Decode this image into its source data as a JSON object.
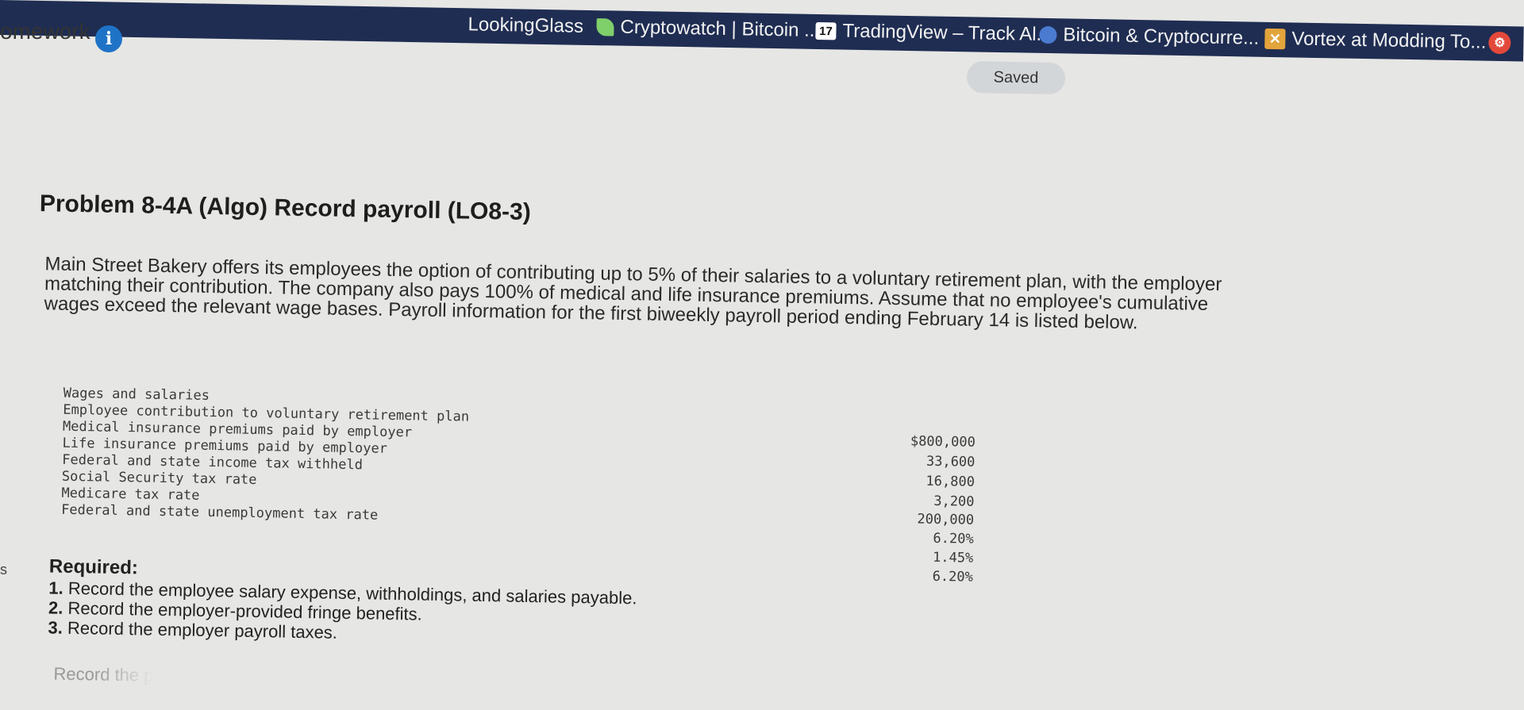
{
  "bookmarks": [
    {
      "label": "LookingGlass",
      "icon": "none-icon"
    },
    {
      "label": "Cryptowatch | Bitcoin ...",
      "icon": "leaf-icon"
    },
    {
      "label": "TradingView – Track Al...",
      "icon": "tradingview-icon",
      "icon_text": "17"
    },
    {
      "label": "Bitcoin & Cryptocurre...",
      "icon": "circle-icon"
    },
    {
      "label": "Vortex at Modding To...",
      "icon": "x-icon"
    }
  ],
  "app": {
    "title": "omework",
    "info_glyph": "i",
    "saved_label": "Saved"
  },
  "problem": {
    "title": "Problem 8-4A (Algo) Record payroll (LO8-3)",
    "description": "Main Street Bakery offers its employees the option of contributing up to 5% of their salaries to a voluntary retirement plan, with the employer matching their contribution. The company also pays 100% of medical and life insurance premiums. Assume that no employee's cumulative wages exceed the relevant wage bases. Payroll information for the first biweekly payroll period ending February 14 is listed below.",
    "labels": [
      "Wages and salaries",
      "Employee contribution to voluntary retirement plan",
      "Medical insurance premiums paid by employer",
      "Life insurance premiums paid by employer",
      "Federal and state income tax withheld",
      "Social Security tax rate",
      "Medicare tax rate",
      "Federal and state unemployment tax rate"
    ],
    "values": [
      "$800,000",
      "33,600",
      "16,800",
      "3,200",
      "200,000",
      "6.20%",
      "1.45%",
      "6.20%"
    ]
  },
  "required": {
    "title": "Required:",
    "items": [
      {
        "num": "1.",
        "text": "Record the employee salary expense, withholdings, and salaries payable."
      },
      {
        "num": "2.",
        "text": "Record the employer-provided fringe benefits."
      },
      {
        "num": "3.",
        "text": "Record the employer payroll taxes."
      }
    ],
    "trailing_text": "Record the p"
  },
  "left_edge_text": "s"
}
